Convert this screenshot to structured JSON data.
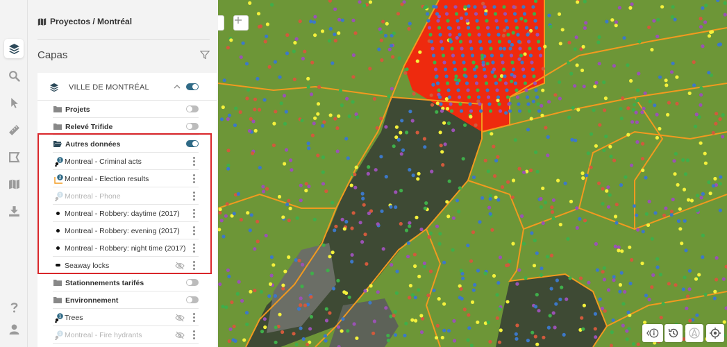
{
  "breadcrumb": "Proyectos / Montréal",
  "panel_title": "Capas",
  "group": {
    "title": "VILLE DE MONTRÉAL",
    "enabled": true
  },
  "layers": [
    {
      "name": "folder-projets",
      "label": "Projets",
      "type": "folder",
      "toggle": false
    },
    {
      "name": "folder-releve-trifide",
      "label": "Relevé Trifide",
      "type": "folder",
      "toggle": false
    },
    {
      "name": "folder-autres-donnees",
      "label": "Autres données",
      "type": "folder-open",
      "toggle": true
    },
    {
      "name": "layer-criminal-acts",
      "label": "Montreal - Criminal acts",
      "type": "cluster",
      "badge": "1"
    },
    {
      "name": "layer-election-results",
      "label": "Montreal - Election results",
      "type": "polygon",
      "badge": "2"
    },
    {
      "name": "layer-phone",
      "label": "Montreal - Phone",
      "type": "cluster-faded",
      "badge": "1"
    },
    {
      "name": "layer-robbery-daytime",
      "label": "Montreal - Robbery: daytime (2017)",
      "type": "dot"
    },
    {
      "name": "layer-robbery-evening",
      "label": "Montreal - Robbery: evening (2017)",
      "type": "dot"
    },
    {
      "name": "layer-robbery-night",
      "label": "Montreal - Robbery: night time (2017)",
      "type": "dot"
    },
    {
      "name": "layer-seaway-locks",
      "label": "Seaway locks",
      "type": "pill",
      "hidden": true
    },
    {
      "name": "folder-stationnements",
      "label": "Stationnements tarifés",
      "type": "folder",
      "toggle": false
    },
    {
      "name": "folder-environnement",
      "label": "Environnement",
      "type": "folder",
      "toggle": false
    },
    {
      "name": "layer-trees",
      "label": "Trees",
      "type": "cluster",
      "badge": "1",
      "hidden": true
    },
    {
      "name": "layer-fire-hydrants",
      "label": "Montreal - Fire hydrants",
      "type": "cluster-faded",
      "badge": "1",
      "hidden": true
    }
  ],
  "colors": {
    "accent": "#2f6a86",
    "highlight": "#d9262a",
    "map_ground": "#6d9637",
    "map_red_zone": "#ee2a0e",
    "boundary": "#f29a1f",
    "points": [
      "#3c78c8",
      "#9a52b4",
      "#f4f13c",
      "#3fae4a",
      "#d15a3c"
    ]
  },
  "icons": {
    "rail": [
      "layers-icon",
      "search-icon",
      "pointer-icon",
      "ruler-icon",
      "draw-icon",
      "map-icon",
      "download-icon",
      "help-icon",
      "user-icon"
    ],
    "map_controls": [
      "info-icon",
      "history-icon",
      "north-arrow-icon",
      "locate-icon"
    ]
  }
}
